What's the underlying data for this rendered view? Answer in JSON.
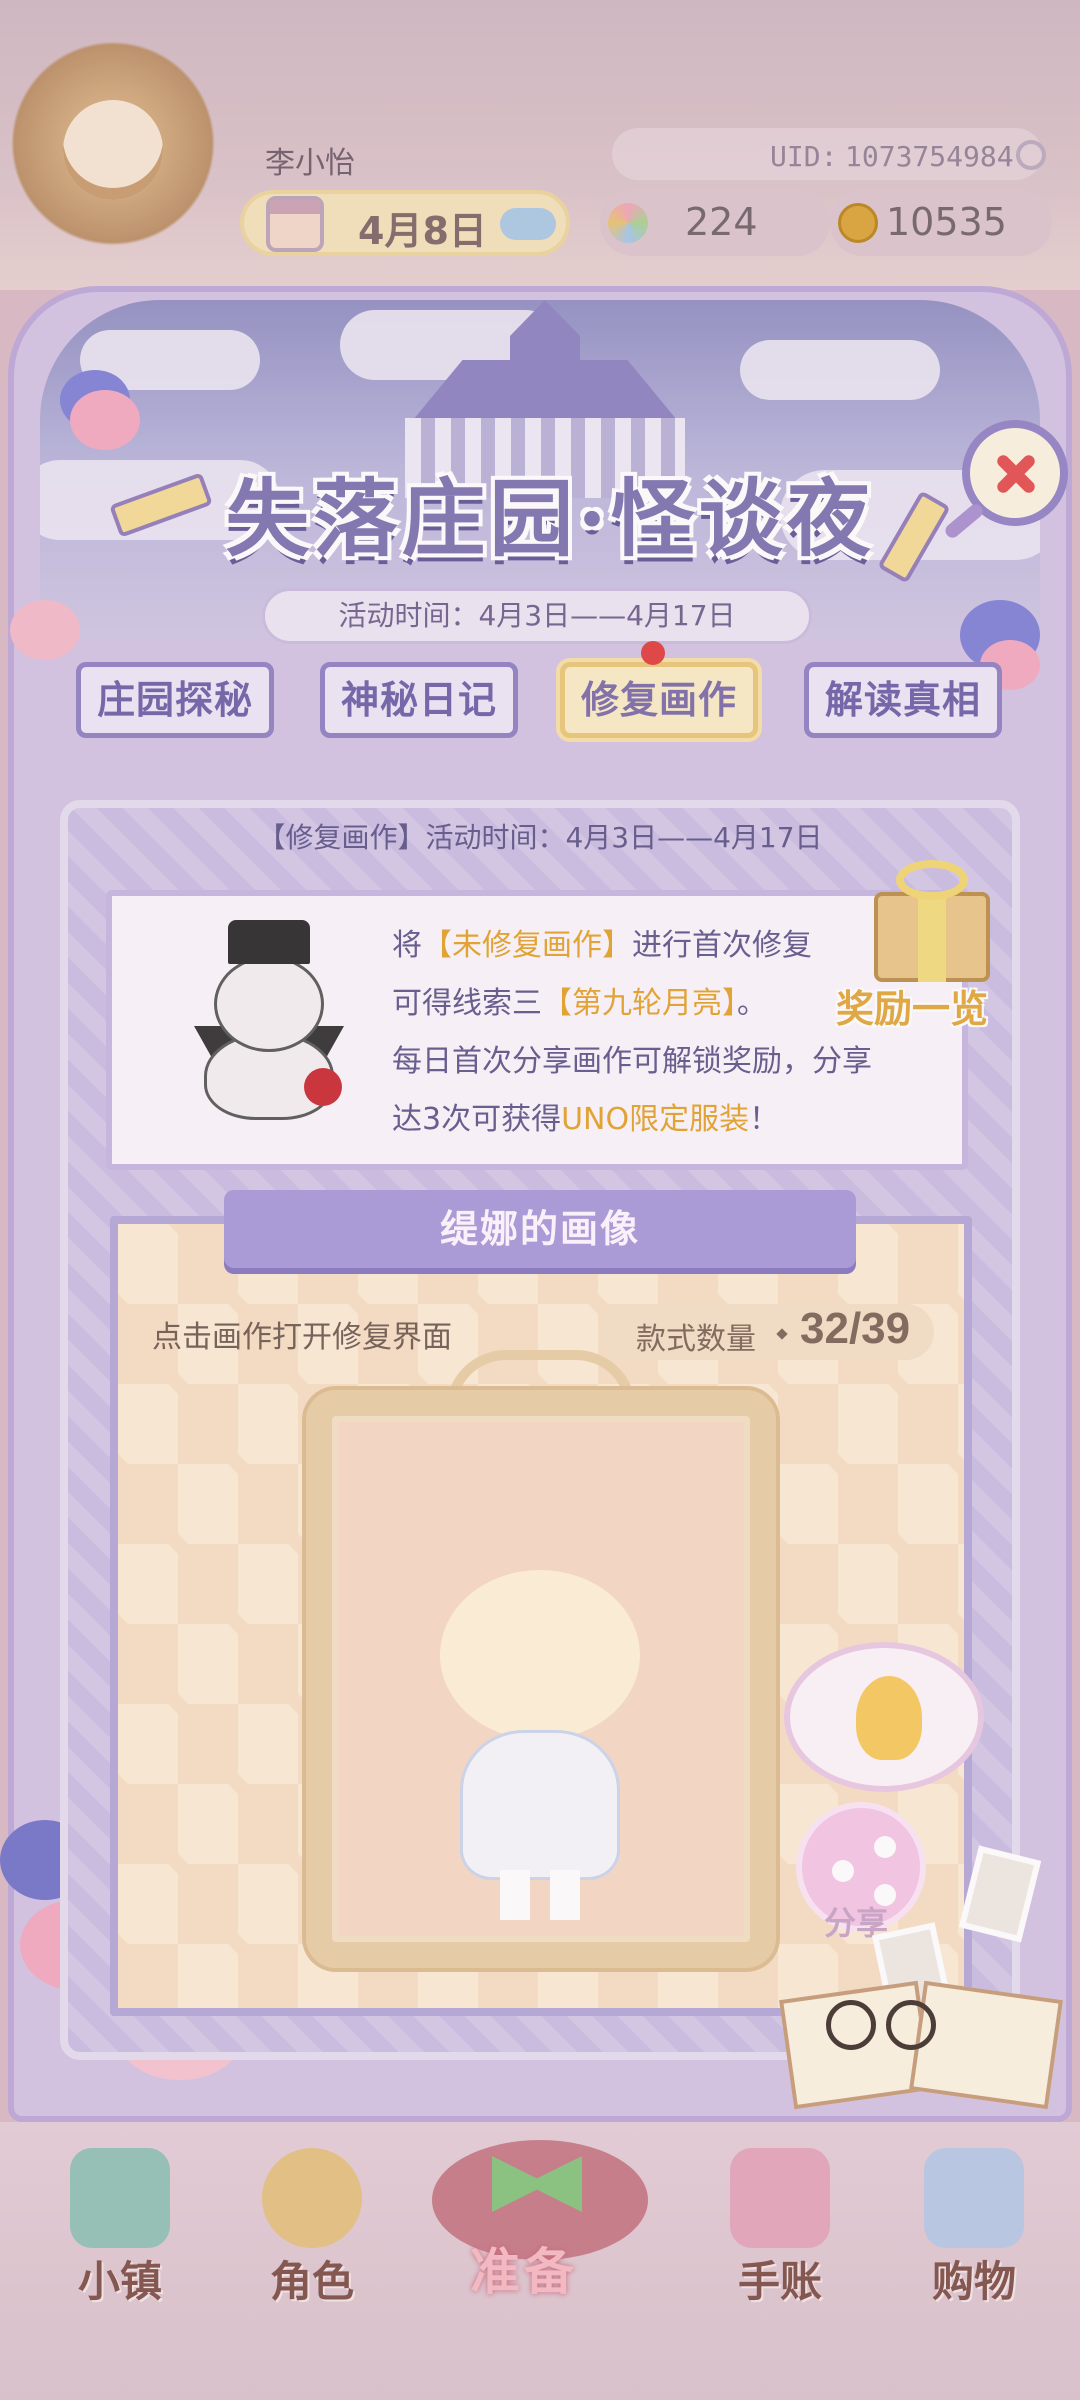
{
  "player": {
    "name": "李小怡",
    "uid_label": "UID:",
    "uid_value": "1073754984"
  },
  "status": {
    "date": "4月8日",
    "gems": "224",
    "coins": "10535"
  },
  "event": {
    "title": "失落庄园·怪谈夜",
    "time": "活动时间：4月3日——4月17日"
  },
  "tabs": [
    {
      "label": "庄园探秘",
      "active": false
    },
    {
      "label": "神秘日记",
      "active": false
    },
    {
      "label": "修复画作",
      "active": true
    },
    {
      "label": "解读真相",
      "active": false
    }
  ],
  "section": {
    "time": "【修复画作】活动时间：4月3日——4月17日",
    "info_lines": [
      {
        "pre": "将",
        "hl": "【未修复画作】",
        "post": "进行首次修复"
      },
      {
        "pre": "可得线索三",
        "hl": "【第九轮月亮】",
        "post": "。"
      },
      {
        "pre": "每日首次分享画作可解锁奖励，分享",
        "hl": "",
        "post": ""
      },
      {
        "pre": "达3次可获得",
        "hl": "UNO限定服装",
        "post": "！"
      }
    ],
    "reward_label": "奖励一览"
  },
  "portrait": {
    "title": "缇娜的画像",
    "hint": "点击画作打开修复界面",
    "count_label": "款式数量",
    "count_value": "32/39",
    "share_label": "分享"
  },
  "bottom_nav": [
    {
      "label": "小镇",
      "icon": "map-icon"
    },
    {
      "label": "角色",
      "icon": "character-icon"
    },
    {
      "label": "准备",
      "icon": "prepare-hat-icon"
    },
    {
      "label": "手账",
      "icon": "journal-icon"
    },
    {
      "label": "购物",
      "icon": "shopping-bag-icon"
    }
  ],
  "colors": {
    "panel": "#d2c3e2",
    "accent_purple": "#8d7fc2",
    "highlight_gold": "#e2a126",
    "close_red": "#e34c4c"
  }
}
